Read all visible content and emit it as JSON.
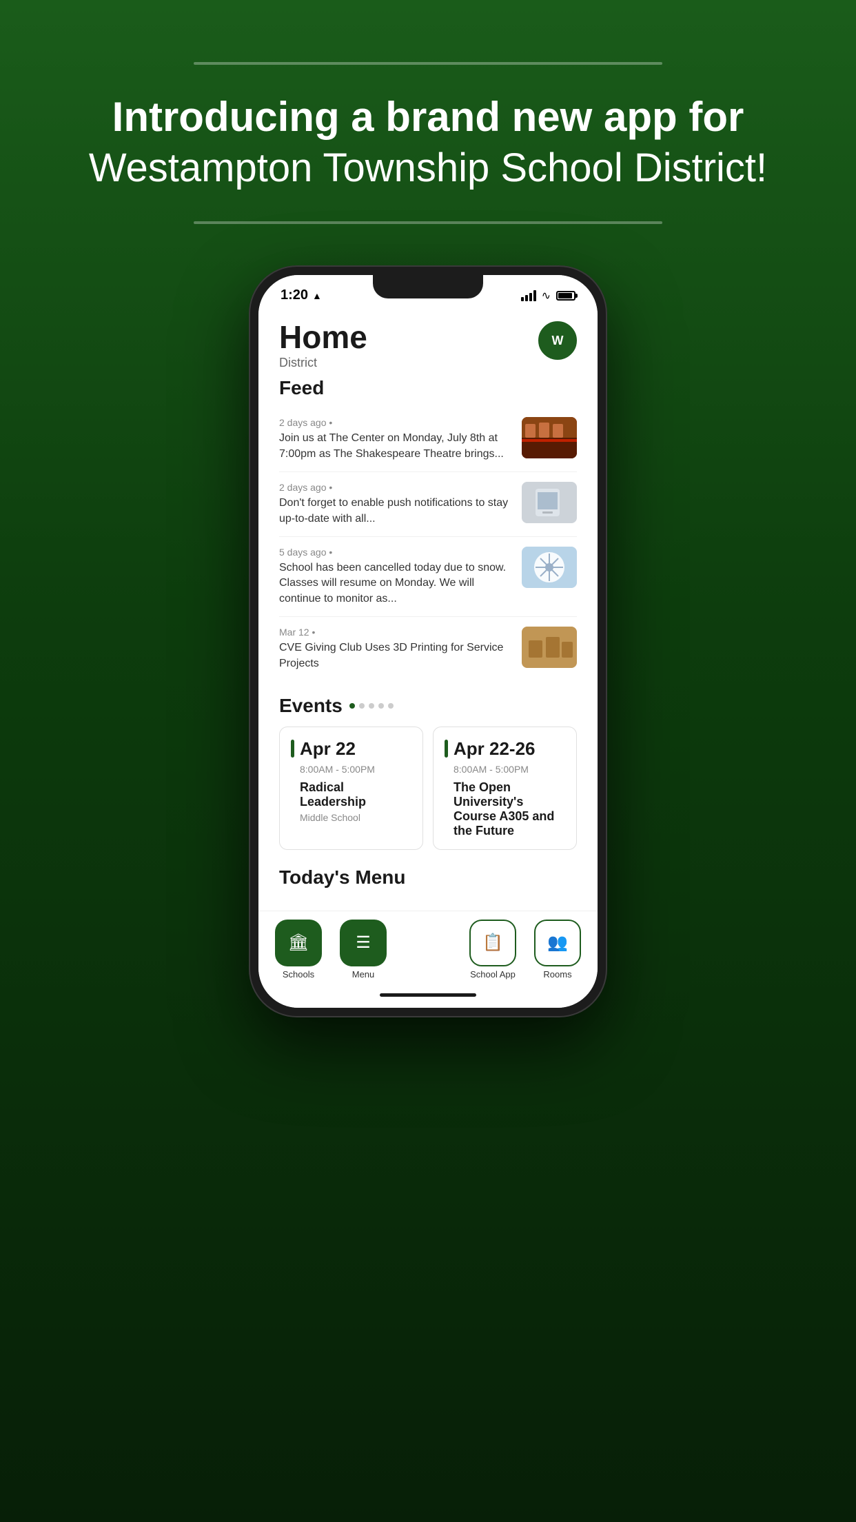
{
  "page": {
    "background": "#0d3d0d"
  },
  "headline": {
    "bold": "Introducing a brand new app for",
    "regular": "Westampton Township School District!"
  },
  "phone": {
    "status": {
      "time": "1:20",
      "arrow": "▶"
    },
    "header": {
      "title": "Home",
      "subtitle": "District",
      "logo_text": "W"
    },
    "feed": {
      "section_title": "Feed",
      "items": [
        {
          "meta": "2 days ago • ",
          "text": "Join us at The Center on Monday, July 8th at 7:00pm as The Shakespeare Theatre brings...",
          "img_type": "theater"
        },
        {
          "meta": "2 days ago • ",
          "text": "Don't forget to enable push notifications to stay up-to-date with all...",
          "img_type": "phone"
        },
        {
          "meta": "5 days ago • ",
          "text": "School has been cancelled today due to snow. Classes will resume on Monday. We will continue to monitor as...",
          "img_type": "snow"
        },
        {
          "meta": "Mar 12 • ",
          "text": "CVE Giving Club Uses 3D Printing for Service Projects",
          "img_type": "3dprint"
        }
      ]
    },
    "events": {
      "section_title": "Events",
      "dots": [
        true,
        false,
        false,
        false,
        false
      ],
      "items": [
        {
          "date": "Apr 22",
          "time": "8:00AM - 5:00PM",
          "name": "Radical Leadership",
          "location": "Middle School"
        },
        {
          "date": "Apr 22-26",
          "time": "8:00AM - 5:00PM",
          "name": "The Open University's Course A305 and the Future",
          "location": ""
        }
      ]
    },
    "menu": {
      "section_title": "Today's Menu"
    },
    "nav": {
      "items": [
        {
          "label": "Schools",
          "icon": "🏛",
          "type": "filled",
          "id": "schools"
        },
        {
          "label": "Menu",
          "icon": "☰",
          "type": "filled",
          "id": "menu"
        },
        {
          "label": "School App",
          "icon": "📋",
          "type": "outline",
          "id": "school-app"
        },
        {
          "label": "Rooms",
          "icon": "👥",
          "type": "outline",
          "id": "rooms"
        }
      ]
    }
  }
}
